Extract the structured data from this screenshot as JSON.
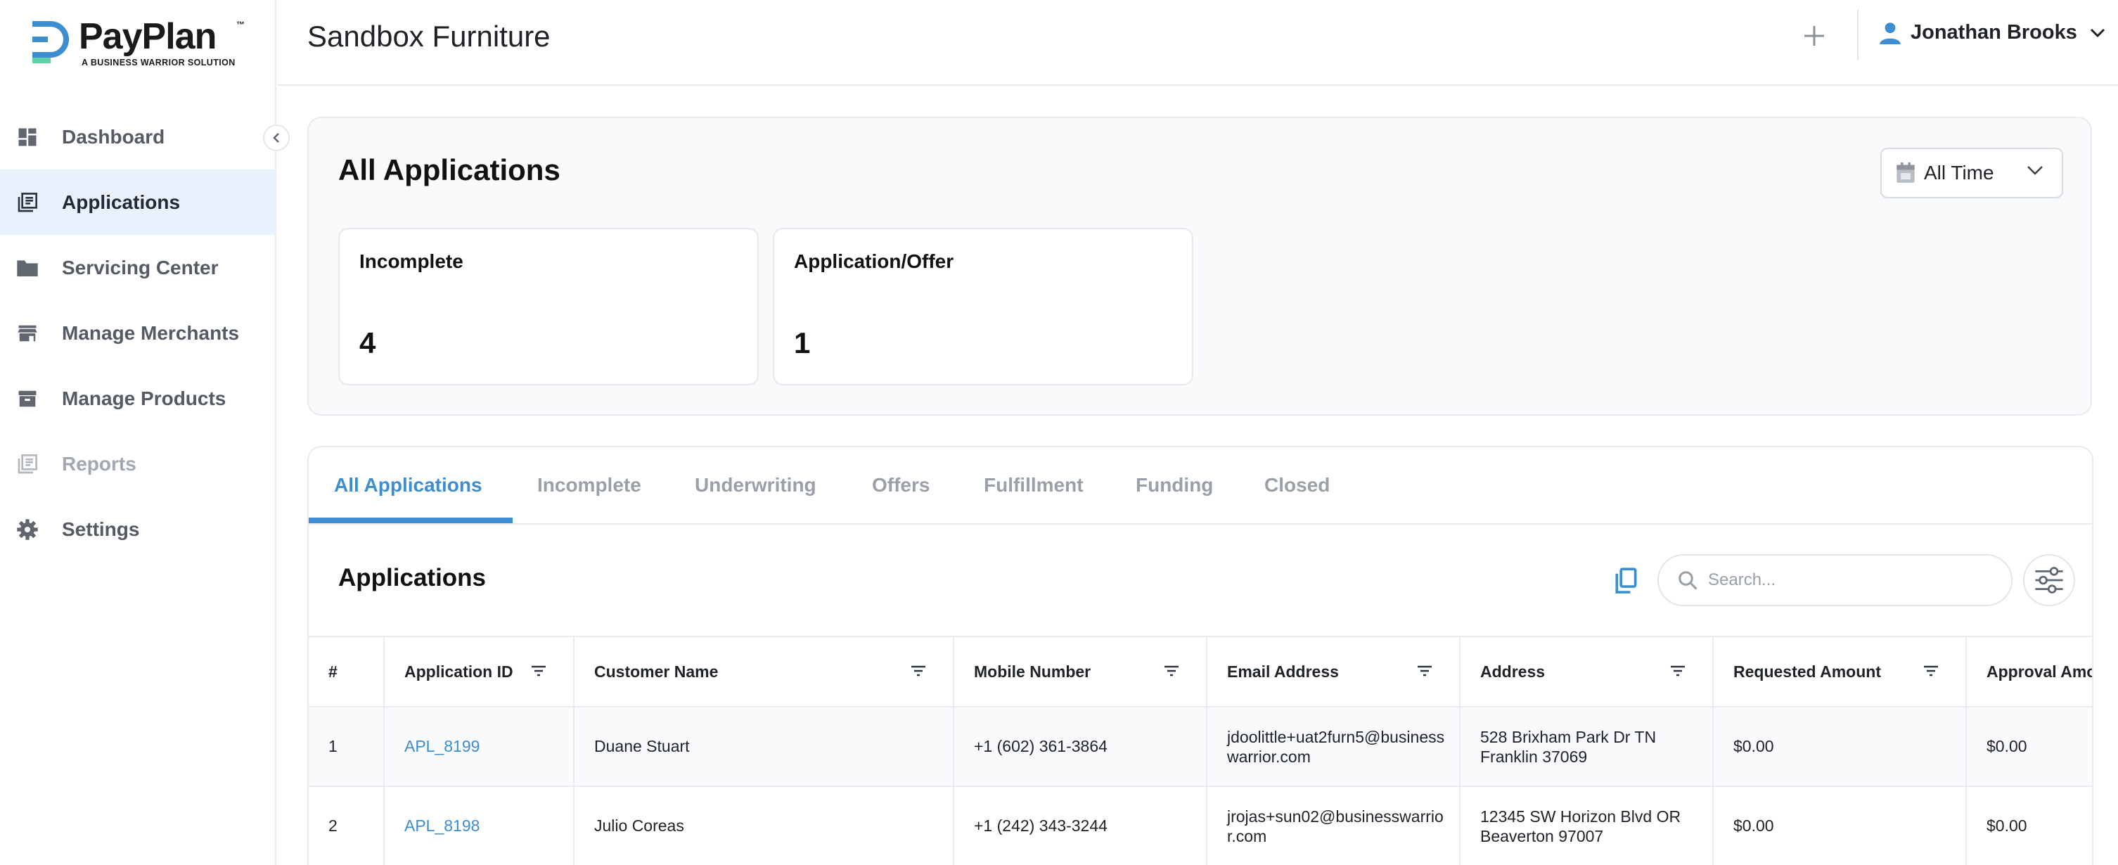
{
  "brand": {
    "name": "PayPlan",
    "tm": "™",
    "tagline": "A BUSINESS WARRIOR SOLUTION",
    "mark_colors": [
      "#3d8dd1",
      "#5fd3a4"
    ]
  },
  "sidebar": {
    "items": [
      {
        "label": "Dashboard",
        "icon": "dashboard-icon",
        "active": false,
        "disabled": false
      },
      {
        "label": "Applications",
        "icon": "applications-icon",
        "active": true,
        "disabled": false
      },
      {
        "label": "Servicing Center",
        "icon": "folder-icon",
        "active": false,
        "disabled": false
      },
      {
        "label": "Manage Merchants",
        "icon": "store-icon",
        "active": false,
        "disabled": false
      },
      {
        "label": "Manage Products",
        "icon": "archive-icon",
        "active": false,
        "disabled": false
      },
      {
        "label": "Reports",
        "icon": "reports-icon",
        "active": false,
        "disabled": true
      },
      {
        "label": "Settings",
        "icon": "gear-icon",
        "active": false,
        "disabled": false
      }
    ]
  },
  "header": {
    "title": "Sandbox Furniture",
    "user_name": "Jonathan Brooks"
  },
  "summary": {
    "title": "All Applications",
    "time_filter": "All Time",
    "stats": [
      {
        "label": "Incomplete",
        "value": "4"
      },
      {
        "label": "Application/Offer",
        "value": "1"
      }
    ]
  },
  "tabs": [
    {
      "label": "All Applications",
      "active": true
    },
    {
      "label": "Incomplete",
      "active": false
    },
    {
      "label": "Underwriting",
      "active": false
    },
    {
      "label": "Offers",
      "active": false
    },
    {
      "label": "Fulfillment",
      "active": false
    },
    {
      "label": "Funding",
      "active": false
    },
    {
      "label": "Closed",
      "active": false
    }
  ],
  "applications": {
    "title": "Applications",
    "search_placeholder": "Search...",
    "columns": [
      "#",
      "Application ID",
      "Customer Name",
      "Mobile Number",
      "Email Address",
      "Address",
      "Requested Amount",
      "Approval Amo"
    ],
    "rows": [
      {
        "num": "1",
        "id": "APL_8199",
        "name": "Duane Stuart",
        "mobile": "+1 (602) 361-3864",
        "email": "jdoolittle+uat2furn5@businesswarrior.com",
        "address": "528 Brixham Park Dr TN Franklin 37069",
        "requested": "$0.00",
        "approval": "$0.00"
      },
      {
        "num": "2",
        "id": "APL_8198",
        "name": "Julio Coreas",
        "mobile": "+1 (242) 343-3244",
        "email": "jrojas+sun02@businesswarrior.com",
        "address": "12345 SW Horizon Blvd OR Beaverton 97007",
        "requested": "$0.00",
        "approval": "$0.00"
      }
    ]
  },
  "colors": {
    "accent": "#3d8dd1",
    "active_nav_bg": "#e9f1fc",
    "muted_text": "#9aa0a8"
  }
}
